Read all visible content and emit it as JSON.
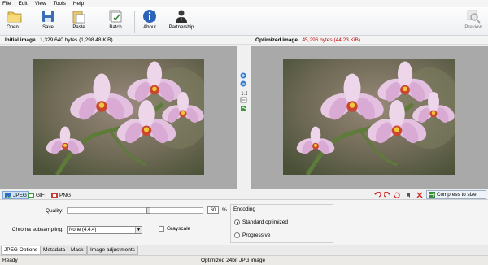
{
  "menu": [
    "File",
    "Edit",
    "View",
    "Tools",
    "Help"
  ],
  "toolbar": {
    "open": "Open...",
    "save": "Save",
    "paste": "Paste",
    "batch": "Batch",
    "about": "About",
    "partnership": "Partnership",
    "preview": "Preview"
  },
  "images": {
    "initial_label": "Initial image",
    "initial_size": "1,329,640 bytes (1,298.48 KiB)",
    "optimized_label": "Optimized image",
    "optimized_size": "45,296 bytes (44.23 KiB)"
  },
  "formats": [
    "JPEG",
    "GIF",
    "PNG"
  ],
  "compress_button": "Compress to size",
  "options": {
    "quality_label": "Quality:",
    "quality_value": "60",
    "quality_unit": "%",
    "quality_fraction": 0.6,
    "chroma_label": "Chroma subsampling:",
    "chroma_value": "None (4:4:4)",
    "grayscale_label": "Grayscale",
    "encoding_title": "Encoding",
    "encoding_standard": "Standard optimized",
    "encoding_progressive": "Progressive"
  },
  "tabs": [
    "JPEG Options",
    "Metadata",
    "Mask",
    "Image adjustments"
  ],
  "status": {
    "left": "Ready",
    "center": "Optimized 24bit JPG image"
  },
  "colors": {
    "accent_red": "#c01010",
    "active_format": "#cfe3f8",
    "pane_gray": "#a9a9a9"
  }
}
